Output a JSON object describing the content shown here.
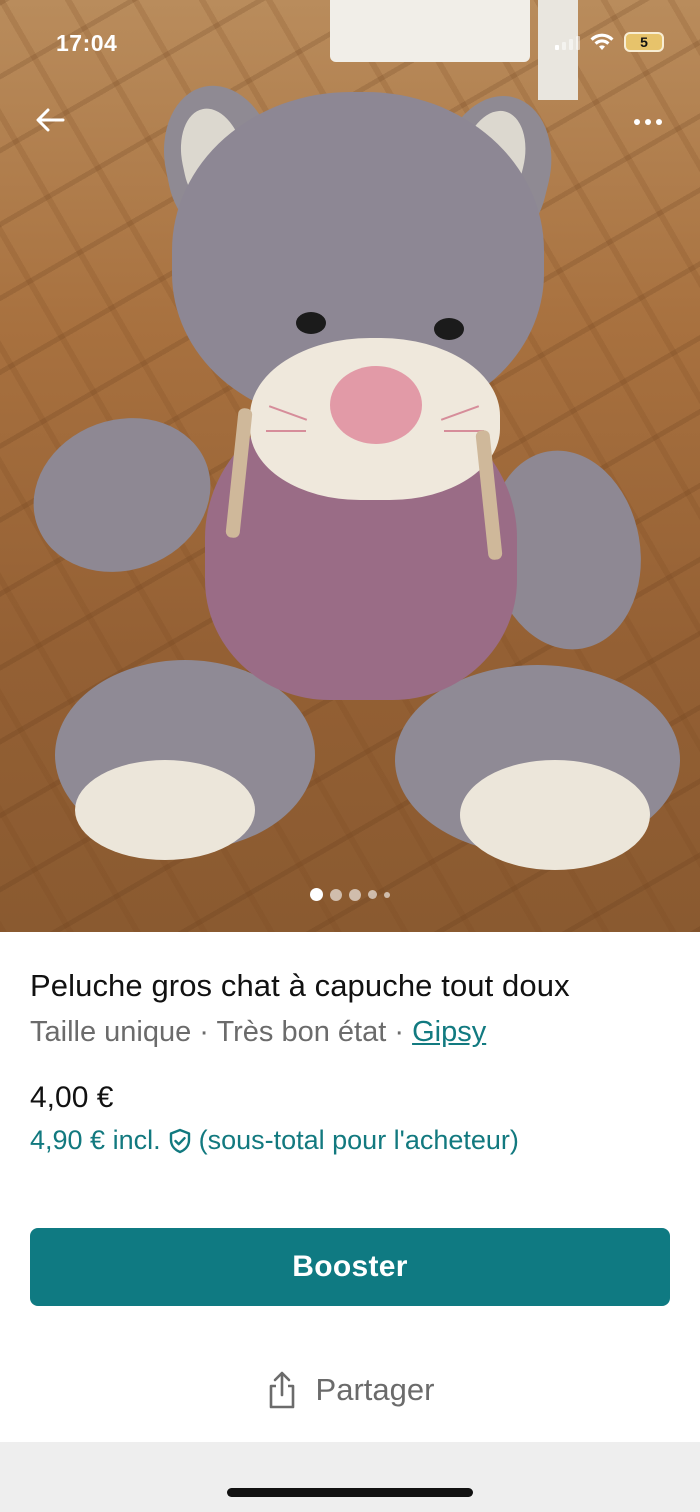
{
  "status_bar": {
    "time": "17:04",
    "battery_level": "5"
  },
  "photo": {
    "subject": "Peluche gros chat à capuche",
    "carousel": {
      "count": 5,
      "active_index": 0
    }
  },
  "nav": {
    "back_icon": "arrow-left-icon",
    "more_icon": "more-horizontal-icon"
  },
  "listing": {
    "title": "Peluche gros chat à capuche tout doux",
    "size": "Taille unique",
    "condition": "Très bon état",
    "brand": "Gipsy",
    "separator": " · ",
    "price": "4,00 €",
    "buyer_price": "4,90 € incl.",
    "buyer_note": "(sous-total pour l'acheteur)"
  },
  "actions": {
    "booster_label": "Booster",
    "share_label": "Partager",
    "share_icon": "share-icon"
  },
  "colors": {
    "accent": "#0f7a82",
    "accent_text": "#12797f",
    "muted_text": "#6b6b6b"
  }
}
